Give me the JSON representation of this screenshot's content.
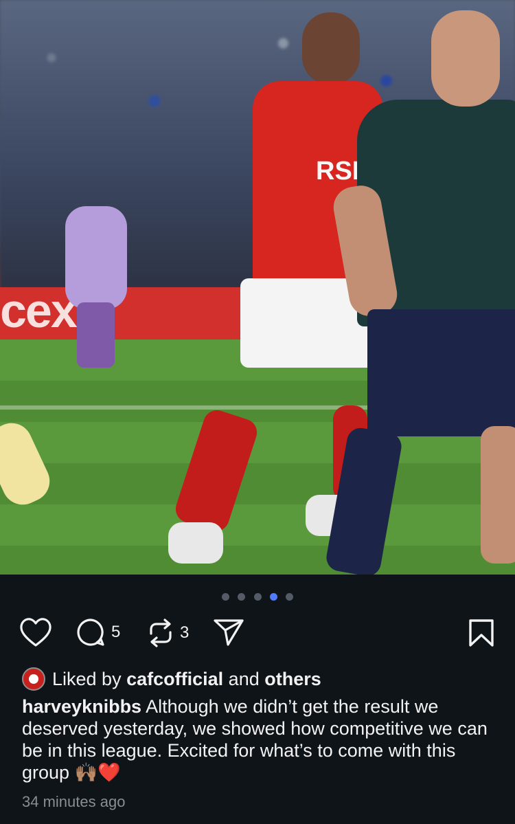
{
  "photo": {
    "sponsor_text": "RSK",
    "ad_text": "cex"
  },
  "carousel": {
    "count": 5,
    "active_index": 3
  },
  "actions": {
    "like_icon": "heart-icon",
    "comment_icon": "comment-icon",
    "comment_count": "5",
    "repost_icon": "repost-icon",
    "repost_count": "3",
    "share_icon": "send-icon",
    "bookmark_icon": "bookmark-icon"
  },
  "likes": {
    "prefix": "Liked by",
    "user": "cafcofficial",
    "joiner": "and",
    "suffix": "others"
  },
  "caption": {
    "username": "harveyknibbs",
    "text": "Although we didn’t get the result we deserved yesterday, we showed how competitive we can be in this league. Excited for what’s to come with this group",
    "emoji": "🙌🏽❤️"
  },
  "timestamp": "34 minutes ago",
  "colors": {
    "background": "#0f1419",
    "active_dot": "#4f7bff",
    "inactive_dot": "#555b66",
    "muted_text": "#8a8d93"
  }
}
